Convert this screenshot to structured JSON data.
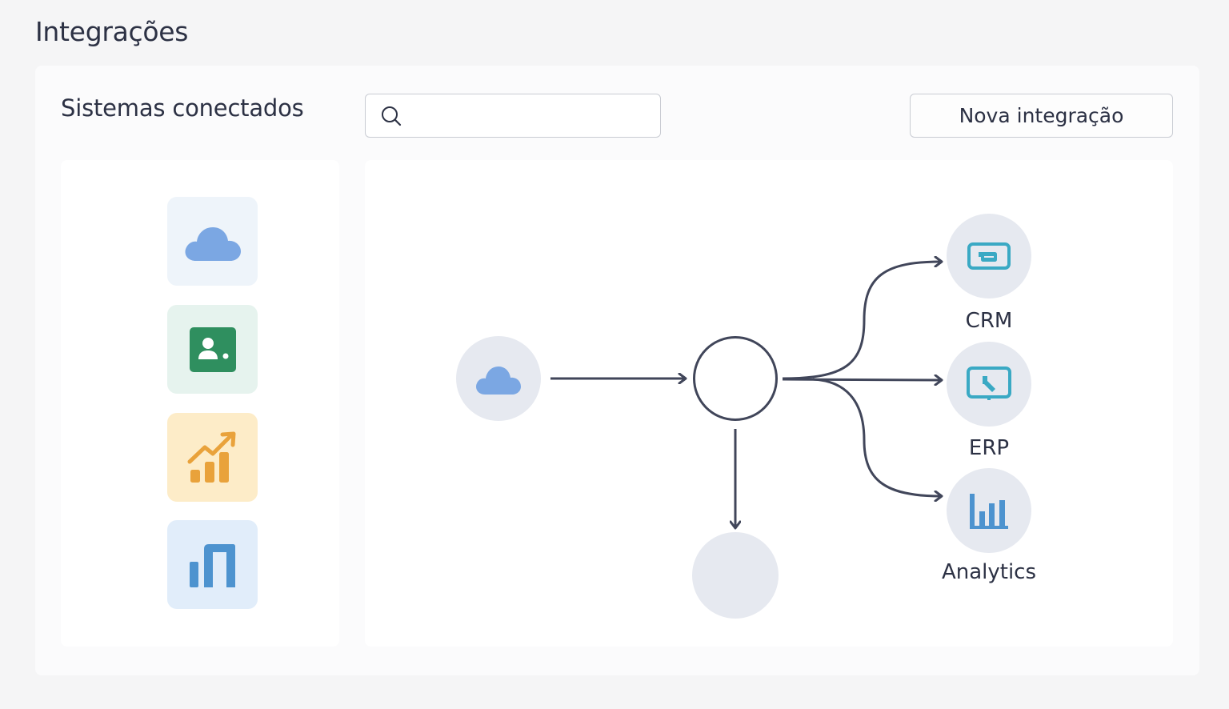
{
  "header": {
    "title": "Integrações"
  },
  "main": {
    "section_title": "Sistemas conectados",
    "search": {
      "placeholder": "",
      "value": ""
    },
    "new_button_label": "Nova integração"
  },
  "systems": [
    {
      "name": "cloud-service",
      "icon": "cloud-icon",
      "color": "#7ba7e3",
      "bg": "#eef4fa"
    },
    {
      "name": "contacts",
      "icon": "contact-card-icon",
      "color": "#2f8f5f",
      "bg": "#e6f3ee"
    },
    {
      "name": "growth-chart",
      "icon": "growth-chart-icon",
      "color": "#e9a23b",
      "bg": "#fdecc8"
    },
    {
      "name": "bar-report",
      "icon": "bar-report-icon",
      "color": "#4d93cf",
      "bg": "#e1edfa"
    }
  ],
  "flow": {
    "source": {
      "icon": "cloud-icon"
    },
    "targets": [
      {
        "label": "CRM",
        "icon": "crm-card-icon"
      },
      {
        "label": "ERP",
        "icon": "erp-screen-icon"
      },
      {
        "label": "Analytics",
        "icon": "analytics-bars-icon"
      }
    ],
    "colors": {
      "line": "#41465a",
      "node_bg": "#e6e9f0",
      "icon_teal": "#3aa9c4",
      "icon_blue": "#4d93cf"
    }
  }
}
